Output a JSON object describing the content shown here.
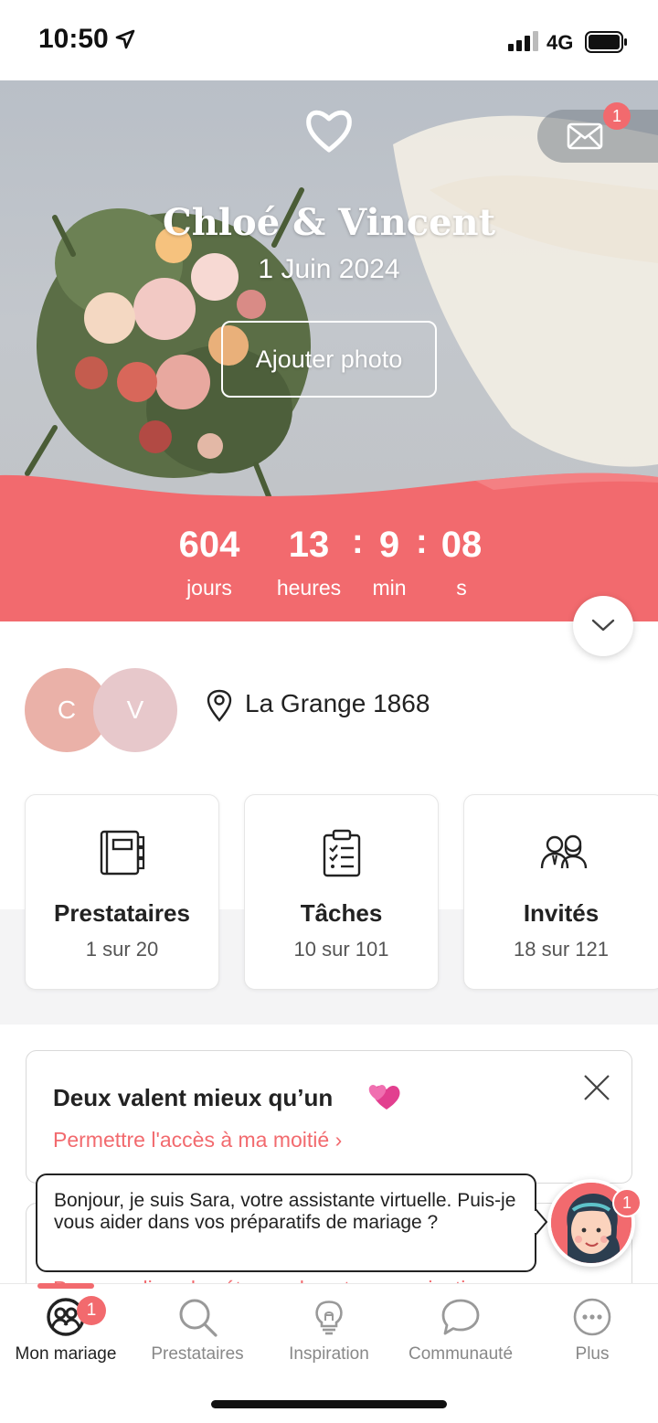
{
  "status_bar": {
    "time": "10:50",
    "network": "4G"
  },
  "hero": {
    "couple_names": "Chloé & Vincent",
    "wedding_date": "1 Juin 2024",
    "add_photo_label": "Ajouter photo",
    "mail_badge": "1"
  },
  "countdown": {
    "days": "604",
    "days_label": "jours",
    "hours": "13",
    "hours_label": "heures",
    "minutes": "9",
    "minutes_label": "min",
    "seconds": "08",
    "seconds_label": "s",
    "separator": ":"
  },
  "profile": {
    "avatar_1": "C",
    "avatar_2": "V",
    "venue": "La Grange 1868"
  },
  "cards": [
    {
      "title": "Prestataires",
      "subtitle": "1 sur 20",
      "icon": "notebook-icon"
    },
    {
      "title": "Tâches",
      "subtitle": "10 sur 101",
      "icon": "checklist-icon"
    },
    {
      "title": "Invités",
      "subtitle": "18 sur 121",
      "icon": "guests-icon"
    }
  ],
  "partner_card": {
    "title": "Deux valent mieux qu’un",
    "link": "Permettre l'accès à ma moitié"
  },
  "next_card": {
    "link": "Personnalisez les étapes de votre organisation"
  },
  "assistant": {
    "message": "Bonjour, je suis Sara, votre assistante virtuelle. Puis-je vous aider dans vos préparatifs de mariage ?",
    "badge": "1"
  },
  "tabbar": {
    "items": [
      {
        "label": "Mon mariage",
        "icon": "couple-icon",
        "active": true,
        "badge": "1"
      },
      {
        "label": "Prestataires",
        "icon": "search-icon"
      },
      {
        "label": "Inspiration",
        "icon": "lightbulb-icon"
      },
      {
        "label": "Communauté",
        "icon": "chat-icon"
      },
      {
        "label": "Plus",
        "icon": "more-icon"
      }
    ]
  },
  "colors": {
    "accent": "#f26a6e",
    "avatar_c": "#eab1a8",
    "avatar_v": "#e7c8cb"
  }
}
